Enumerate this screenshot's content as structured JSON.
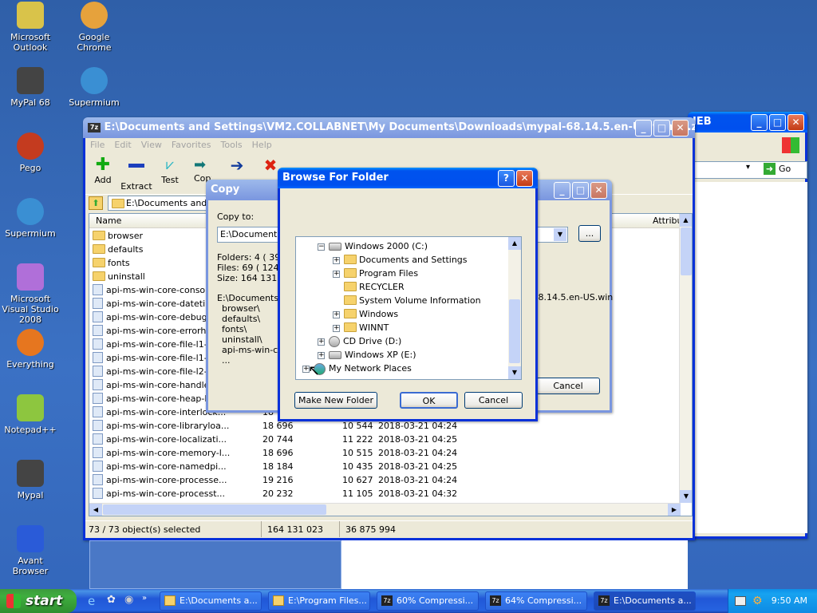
{
  "desktop_icons": [
    {
      "label": "Microsoft Outlook",
      "icon": "outlook-icon"
    },
    {
      "label": "Google Chrome",
      "icon": "chrome-icon"
    },
    {
      "label": "MyPal 68",
      "icon": "mypal-icon"
    },
    {
      "label": "Supermium",
      "icon": "supermium-icon"
    },
    {
      "label": "Pego",
      "icon": "pego-icon"
    },
    {
      "label": "Supermium",
      "icon": "supermium-icon"
    },
    {
      "label": "Microsoft Visual Studio 2008",
      "icon": "visual-studio-icon"
    },
    {
      "label": "Everything",
      "icon": "everything-icon"
    },
    {
      "label": "Notepad++",
      "icon": "notepadpp-icon"
    },
    {
      "label": "Mypal",
      "icon": "mypal-icon"
    },
    {
      "label": "Avant Browser",
      "icon": "avant-browser-icon"
    }
  ],
  "zip_window": {
    "title": "E:\\Documents and Settings\\VM2.COLLABNET\\My Documents\\Downloads\\mypal-68.14.5.en-US.win32.zip\\...",
    "menu": [
      "File",
      "Edit",
      "View",
      "Favorites",
      "Tools",
      "Help"
    ],
    "toolbar": [
      "Add",
      "Extract",
      "Test",
      "Copy"
    ],
    "path": "E:\\Documents and S",
    "columns": {
      "name": "Name",
      "attrib": "Attribu"
    },
    "folders": [
      "browser",
      "defaults",
      "fonts",
      "uninstall"
    ],
    "files": [
      {
        "name": "api-ms-win-core-console-l...",
        "size": "",
        "packed": "",
        "modified": ""
      },
      {
        "name": "api-ms-win-core-datetime...",
        "size": "",
        "packed": "",
        "modified": ""
      },
      {
        "name": "api-ms-win-core-debug-l1...",
        "size": "",
        "packed": "",
        "modified": ""
      },
      {
        "name": "api-ms-win-core-errorhan...",
        "size": "",
        "packed": "",
        "modified": ""
      },
      {
        "name": "api-ms-win-core-file-l1-1...",
        "size": "",
        "packed": "",
        "modified": ""
      },
      {
        "name": "api-ms-win-core-file-l1-2...",
        "size": "",
        "packed": "",
        "modified": ""
      },
      {
        "name": "api-ms-win-core-file-l2-1...",
        "size": "",
        "packed": "",
        "modified": ""
      },
      {
        "name": "api-ms-win-core-handle-l1...",
        "size": "",
        "packed": "",
        "modified": ""
      },
      {
        "name": "api-ms-win-core-heap-l1...",
        "size": "",
        "packed": "",
        "modified": ""
      },
      {
        "name": "api-ms-win-core-interlock...",
        "size": "18 7",
        "packed": "",
        "modified": ""
      },
      {
        "name": "api-ms-win-core-libraryloa...",
        "size": "18 696",
        "packed": "10 544",
        "modified": "2018-03-21 04:24"
      },
      {
        "name": "api-ms-win-core-localizati...",
        "size": "20 744",
        "packed": "11 222",
        "modified": "2018-03-21 04:25"
      },
      {
        "name": "api-ms-win-core-memory-l...",
        "size": "18 696",
        "packed": "10 515",
        "modified": "2018-03-21 04:24"
      },
      {
        "name": "api-ms-win-core-namedpi...",
        "size": "18 184",
        "packed": "10 435",
        "modified": "2018-03-21 04:25"
      },
      {
        "name": "api-ms-win-core-processe...",
        "size": "19 216",
        "packed": "10 627",
        "modified": "2018-03-21 04:24"
      },
      {
        "name": "api-ms-win-core-processt...",
        "size": "20 232",
        "packed": "11 105",
        "modified": "2018-03-21 04:32"
      }
    ],
    "status": {
      "selected": "73 / 73 object(s) selected",
      "size": "164 131 023",
      "packed": "36 875 994"
    }
  },
  "back_window": {
    "title_fragment": "IEB",
    "go_label": "Go",
    "attr_fragment": ".8.14.5.en-US.win"
  },
  "copy_dialog": {
    "title": "Copy",
    "copy_to_label": "Copy to:",
    "copy_to_value": "E:\\Documents a",
    "browse_label": "...",
    "info": [
      "Folders: 4   ( 39",
      "Files: 69   ( 124",
      "Size: 164 131 02"
    ],
    "paths": [
      "E:\\Documents a",
      "browser\\",
      "defaults\\",
      "fonts\\",
      "uninstall\\",
      "api-ms-win-core",
      "..."
    ],
    "cancel_label": "Cancel"
  },
  "browse_dialog": {
    "title": "Browse For Folder",
    "help_label": "?",
    "tree": [
      {
        "label": "Windows 2000 (C:)",
        "indent": 1,
        "exp": "-",
        "icon": "drive"
      },
      {
        "label": "Documents and Settings",
        "indent": 2,
        "exp": "+",
        "icon": "folder"
      },
      {
        "label": "Program Files",
        "indent": 2,
        "exp": "+",
        "icon": "folder"
      },
      {
        "label": "RECYCLER",
        "indent": 2,
        "exp": "",
        "icon": "folder"
      },
      {
        "label": "System Volume Information",
        "indent": 2,
        "exp": "",
        "icon": "folder"
      },
      {
        "label": "Windows",
        "indent": 2,
        "exp": "+",
        "icon": "folder"
      },
      {
        "label": "WINNT",
        "indent": 2,
        "exp": "+",
        "icon": "folder"
      },
      {
        "label": "CD Drive (D:)",
        "indent": 1,
        "exp": "+",
        "icon": "cd"
      },
      {
        "label": "Windows XP (E:)",
        "indent": 1,
        "exp": "+",
        "icon": "drive"
      },
      {
        "label": "My Network Places",
        "indent": 0,
        "exp": "+",
        "icon": "network"
      }
    ],
    "make_new_folder": "Make New Folder",
    "ok": "OK",
    "cancel": "Cancel"
  },
  "taskbar": {
    "start": "start",
    "tasks": [
      "E:\\Documents a...",
      "E:\\Program Files...",
      "60% Compressi...",
      "64% Compressi...",
      "E:\\Documents a..."
    ],
    "clock": "9:50 AM"
  }
}
